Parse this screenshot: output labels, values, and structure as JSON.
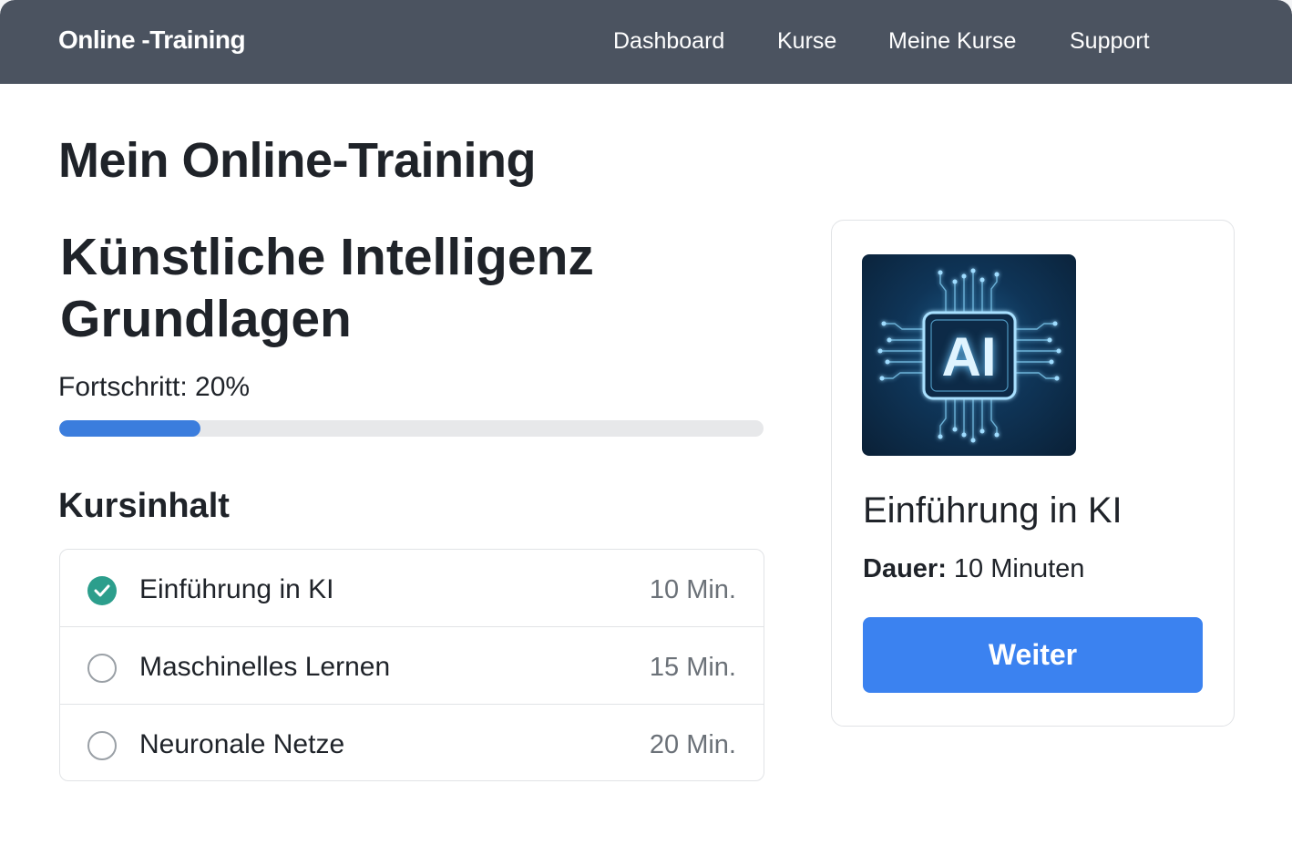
{
  "nav": {
    "brand": "Online -Training",
    "links": [
      {
        "label": "Dashboard"
      },
      {
        "label": "Kurse"
      },
      {
        "label": "Meine Kurse"
      },
      {
        "label": "Support"
      }
    ]
  },
  "main": {
    "page_title": "Mein Online-Training",
    "course_title": "Künstliche Intelligenz Grundlagen",
    "progress_label": "Fortschritt: 20%",
    "progress_percent": 20,
    "section_title": "Kursinhalt",
    "lessons": [
      {
        "name": "Einführung in KI",
        "duration": "10 Min.",
        "completed": true
      },
      {
        "name": "Maschinelles Lernen",
        "duration": "15 Min.",
        "completed": false
      },
      {
        "name": "Neuronale Netze",
        "duration": "20 Min.",
        "completed": false
      }
    ]
  },
  "card": {
    "image_text": "AI",
    "image_icon": "ai-chip-icon",
    "title": "Einführung in KI",
    "duration_label": "Dauer:",
    "duration_value": "10 Minuten",
    "button_label": "Weiter"
  },
  "colors": {
    "navbar": "#4b5360",
    "accent": "#3b82f0",
    "progress": "#3b7ddd",
    "check": "#2c9e8c"
  }
}
